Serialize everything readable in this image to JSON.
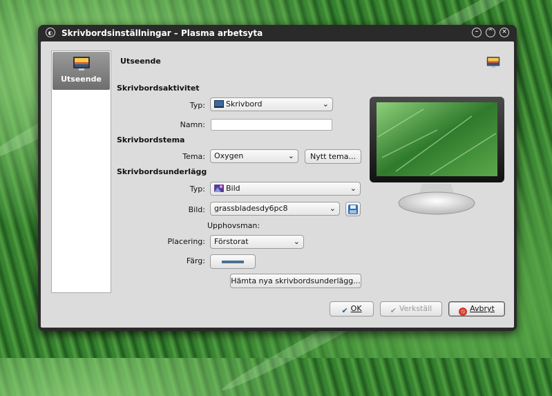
{
  "window": {
    "title": "Skrivbordsinställningar – Plasma arbetsyta",
    "controls": [
      "minimize",
      "maximize",
      "close"
    ]
  },
  "sidebar": {
    "items": [
      {
        "label": "Utseende",
        "icon": "monitor-wallpaper-icon",
        "selected": true
      }
    ]
  },
  "page": {
    "title": "Utseende",
    "icon": "monitor-wallpaper-icon"
  },
  "activity": {
    "heading": "Skrivbordsaktivitet",
    "type_label": "Typ:",
    "type_value": "Skrivbord",
    "name_label": "Namn:",
    "name_value": ""
  },
  "theme": {
    "heading": "Skrivbordstema",
    "label": "Tema:",
    "value": "Oxygen",
    "new_button": "Nytt tema..."
  },
  "wallpaper": {
    "heading": "Skrivbordsunderlägg",
    "type_label": "Typ:",
    "type_value": "Bild",
    "image_label": "Bild:",
    "image_value": "grassbladesdy6pc8",
    "author_label": "Upphovsman:",
    "placement_label": "Placering:",
    "placement_value": "Förstorat",
    "color_label": "Färg:",
    "color_value": "#4a6f8f",
    "get_new_button": "Hämta nya skrivbordsunderlägg..."
  },
  "footer": {
    "ok": "OK",
    "apply": "Verkställ",
    "cancel": "Avbryt"
  }
}
